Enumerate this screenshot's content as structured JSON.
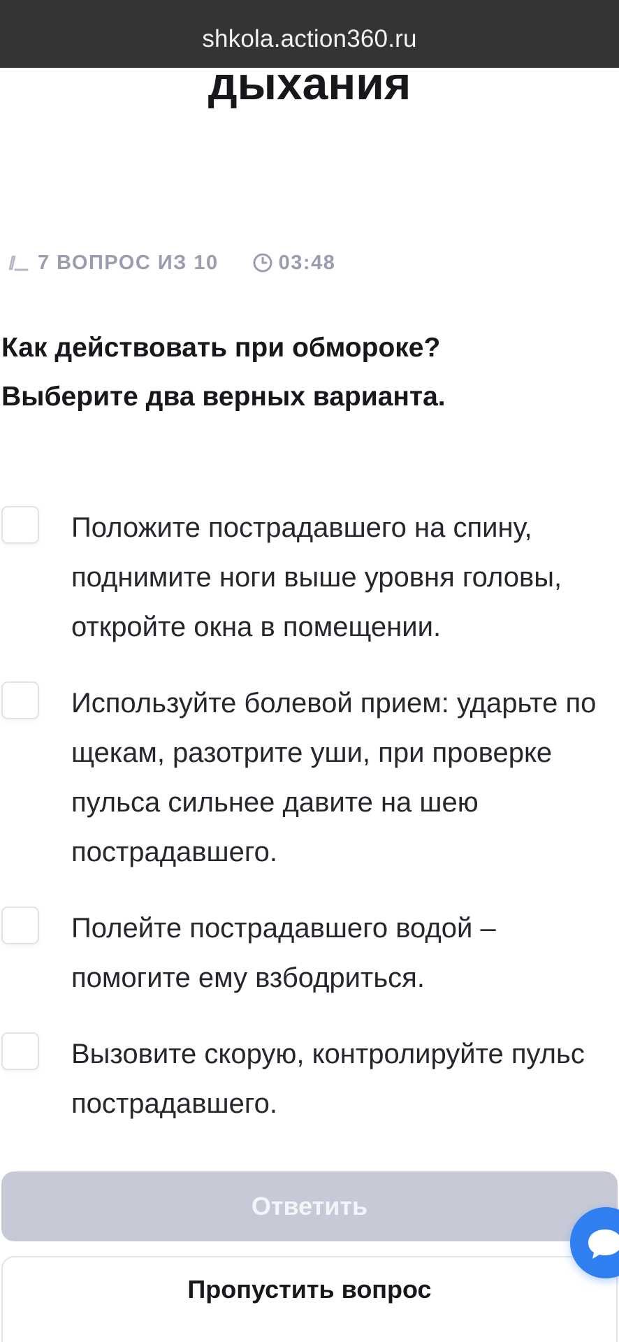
{
  "browser": {
    "url": "shkola.action360.ru"
  },
  "page": {
    "title_fragment": "дыхания"
  },
  "quiz": {
    "progress_text": "7 ВОПРОС ИЗ 10",
    "progress_current": 7,
    "progress_total": 10,
    "timer": "03:48",
    "question": "Как действовать при обмороке? Выберите два верных варианта.",
    "options": [
      {
        "label": "Положите пострадавшего на спину, поднимите ноги выше уровня головы, откройте окна в помещении.",
        "checked": false
      },
      {
        "label": "Используйте болевой прием: ударьте по щекам, разотрите уши, при проверке пульса сильнее давите на шею пострадавшего.",
        "checked": false
      },
      {
        "label": "Полейте пострадавшего водой – помогите ему взбодриться.",
        "checked": false
      },
      {
        "label": "Вызовите скорую, контролируйте пульс пострадавшего.",
        "checked": false
      }
    ],
    "answer_button": "Ответить",
    "skip_button": "Пропустить вопрос"
  },
  "icons": {
    "progress": "pencil-icon",
    "timer": "clock-icon",
    "chat": "chat-bubble-icon"
  },
  "colors": {
    "url_bar": "#343437",
    "answer_button_disabled": "#c7c9d7",
    "meta_text": "#9a9caf",
    "chat_button": "#2f7ff0"
  }
}
